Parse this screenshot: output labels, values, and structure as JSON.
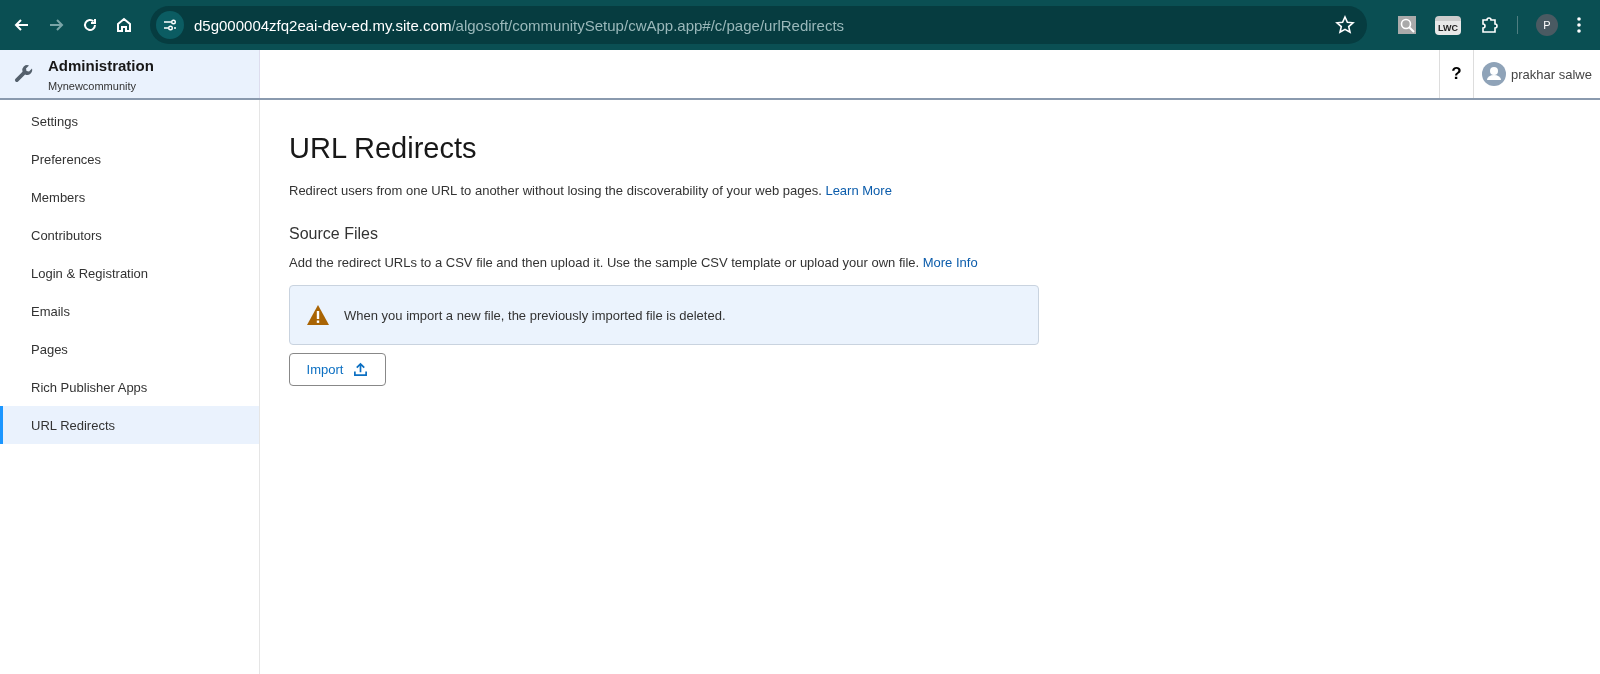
{
  "browser": {
    "address": {
      "host": "d5g000004zfq2eai-dev-ed.my.site.com",
      "path": "/algosoft/communitySetup/cwApp.app#/c/page/urlRedirects"
    },
    "extension_badge": "LWC",
    "profile_initial": "P"
  },
  "header": {
    "title": "Administration",
    "subtitle": "Mynewcommunity",
    "help": "?",
    "user": "prakhar salwe"
  },
  "sidebar": {
    "items": [
      {
        "label": "Settings",
        "selected": false
      },
      {
        "label": "Preferences",
        "selected": false
      },
      {
        "label": "Members",
        "selected": false
      },
      {
        "label": "Contributors",
        "selected": false
      },
      {
        "label": "Login & Registration",
        "selected": false
      },
      {
        "label": "Emails",
        "selected": false
      },
      {
        "label": "Pages",
        "selected": false
      },
      {
        "label": "Rich Publisher Apps",
        "selected": false
      },
      {
        "label": "URL Redirects",
        "selected": true
      }
    ]
  },
  "content": {
    "title": "URL Redirects",
    "description": "Redirect users from one URL to another without losing the discoverability of your web pages.",
    "description_link": "Learn More",
    "section_title": "Source Files",
    "section_text": "Add the redirect URLs to a CSV file and then upload it. Use the sample CSV template or upload your own file.",
    "section_link": "More Info",
    "warning": "When you import a new file, the previously imported file is deleted.",
    "import_button": "Import"
  }
}
